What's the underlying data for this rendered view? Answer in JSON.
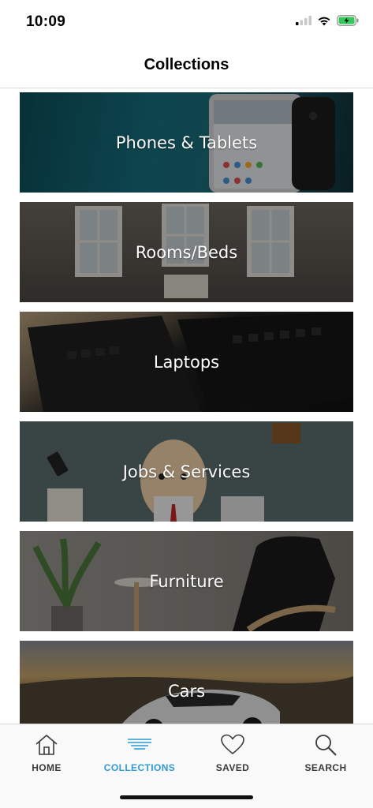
{
  "status_bar": {
    "time": "10:09",
    "icons": [
      "signal-icon",
      "wifi-icon",
      "battery-icon"
    ],
    "battery_color": "#34c759"
  },
  "nav": {
    "title": "Collections"
  },
  "collections": [
    {
      "label": "Phones & Tablets"
    },
    {
      "label": "Rooms/Beds"
    },
    {
      "label": "Laptops"
    },
    {
      "label": "Jobs & Services"
    },
    {
      "label": "Furniture"
    },
    {
      "label": "Cars"
    }
  ],
  "tab_bar": {
    "active_color": "#2e9bd6",
    "tabs": [
      {
        "label": "HOME",
        "icon": "home-icon"
      },
      {
        "label": "COLLECTIONS",
        "icon": "collections-icon"
      },
      {
        "label": "SAVED",
        "icon": "heart-icon"
      },
      {
        "label": "SEARCH",
        "icon": "search-icon"
      }
    ]
  }
}
